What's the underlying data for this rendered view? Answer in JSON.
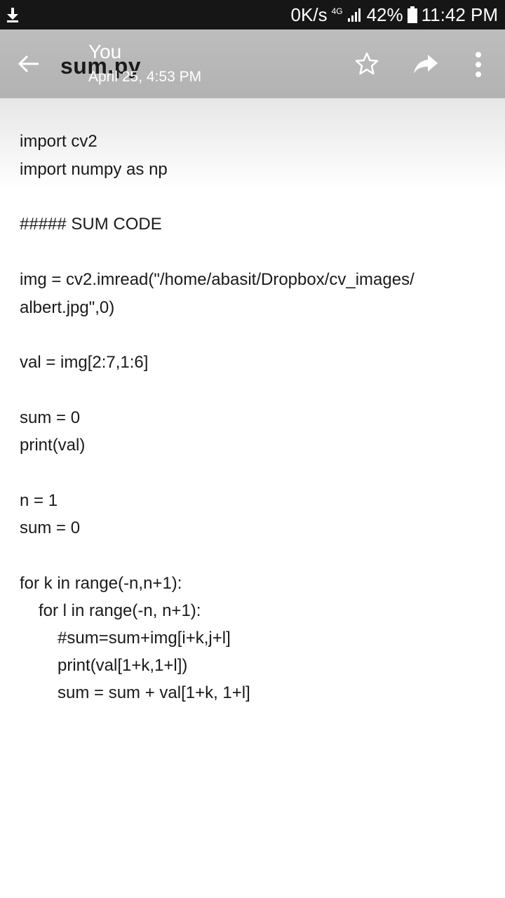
{
  "status_bar": {
    "net_speed": "0K/s",
    "net_type": "4G",
    "battery": "42%",
    "time": "11:42 PM",
    "icons": [
      "download-icon",
      "signal-icon",
      "battery-icon"
    ]
  },
  "header": {
    "file_name": "sum.py",
    "sender": "You",
    "timestamp": "April 25, 4:53 PM",
    "icons": [
      "back-arrow-icon",
      "star-icon",
      "share-icon",
      "more-vert-icon"
    ]
  },
  "code": {
    "lines": [
      "import cv2",
      "import numpy as np",
      "##### SUM CODE",
      "img = cv2.imread(\"/home/abasit/Dropbox/cv_images/",
      "albert.jpg\",0)",
      "val = img[2:7,1:6]",
      "sum = 0",
      "print(val)",
      "n = 1",
      "sum = 0",
      "for k in range(-n,n+1):",
      "for l in range(-n, n+1):",
      "#sum=sum+img[i+k,j+l]",
      "print(val[1+k,1+l])",
      "sum = sum + val[1+k, 1+l]"
    ]
  },
  "colors": {
    "status_bar_bg": "#161616",
    "toolbar_bg": "#b8b8b8",
    "text": "#1a1a1a"
  }
}
